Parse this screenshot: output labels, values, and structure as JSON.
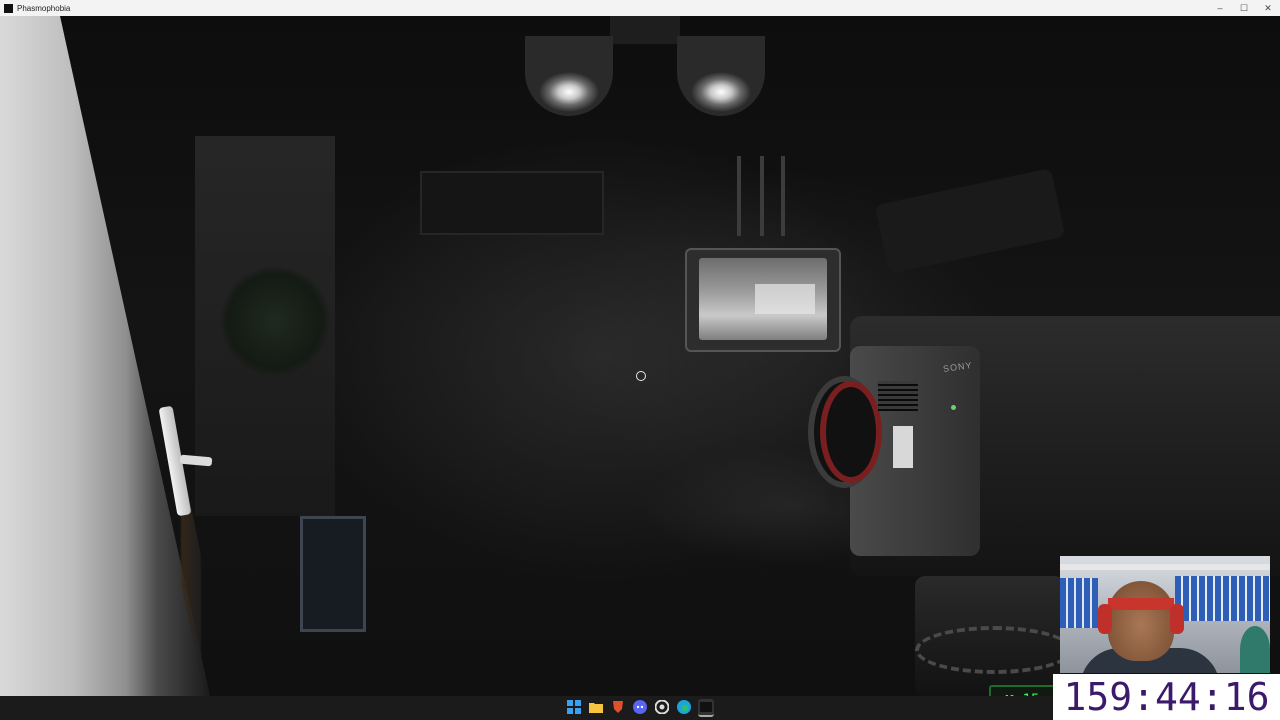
{
  "window": {
    "title": "Phasmophobia",
    "controls": [
      "–",
      "☐",
      "✕"
    ]
  },
  "overlay": {
    "timer": "159:44:16",
    "badge_count": "15"
  },
  "taskbar": {
    "icons": [
      {
        "name": "windows-start",
        "color": "#3aa0f0"
      },
      {
        "name": "file-explorer",
        "color": "#f5c542"
      },
      {
        "name": "brave-browser",
        "color": "#e0502d"
      },
      {
        "name": "discord",
        "color": "#5865f2"
      },
      {
        "name": "chrome",
        "color": "#dddddd"
      },
      {
        "name": "edge",
        "color": "#1fa3d8"
      },
      {
        "name": "game-app",
        "color": "#333333"
      }
    ]
  },
  "camera": {
    "brand": "SONY"
  },
  "colors": {
    "timer_text": "#3c1a6b",
    "badge_green": "#2dff55"
  }
}
